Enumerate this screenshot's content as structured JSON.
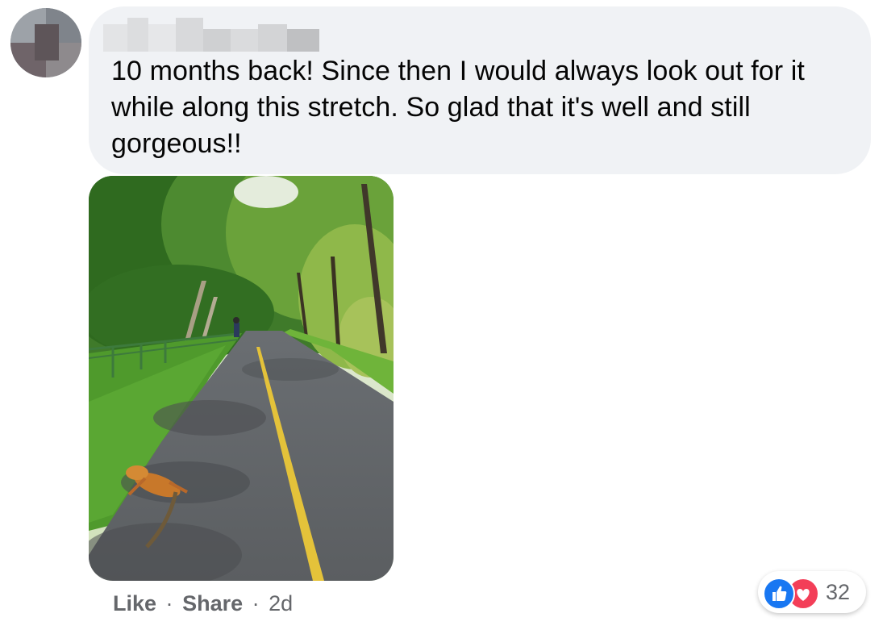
{
  "comment": {
    "author": "",
    "text": "10 months back! Since then I would always look out for it while along this stretch. So glad that it's well and still gorgeous!!"
  },
  "actions": {
    "like_label": "Like",
    "separator": "·",
    "share_label": "Share",
    "timestamp": "2d"
  },
  "reactions": {
    "icons": [
      "like-icon",
      "love-icon"
    ],
    "count": "32",
    "colors": {
      "like": "#1877f2",
      "love": "#f33e58"
    }
  },
  "colors": {
    "bubble_bg": "#f0f2f5",
    "text": "#050505",
    "secondary_text": "#65676b"
  }
}
